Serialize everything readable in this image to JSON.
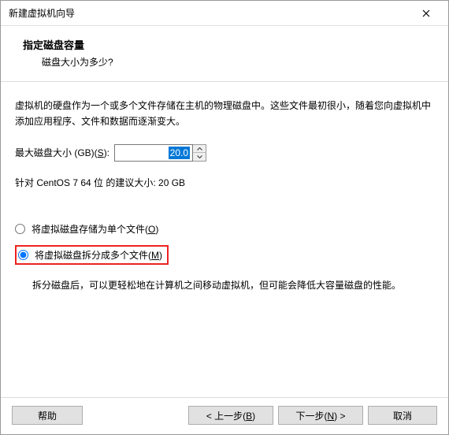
{
  "window": {
    "title": "新建虚拟机向导"
  },
  "header": {
    "title": "指定磁盘容量",
    "subtitle": "磁盘大小为多少?"
  },
  "content": {
    "description": "虚拟机的硬盘作为一个或多个文件存储在主机的物理磁盘中。这些文件最初很小，随着您向虚拟机中添加应用程序、文件和数据而逐渐变大。",
    "size_label_prefix": "最大磁盘大小 (GB)(",
    "size_label_hotkey": "S",
    "size_label_suffix": "):",
    "size_value": "20.0",
    "recommendation": "针对 CentOS 7 64 位 的建议大小: 20 GB",
    "radio_single_prefix": "将虚拟磁盘存储为单个文件(",
    "radio_single_hotkey": "O",
    "radio_single_suffix": ")",
    "radio_split_prefix": "将虚拟磁盘拆分成多个文件(",
    "radio_split_hotkey": "M",
    "radio_split_suffix": ")",
    "split_description": "拆分磁盘后，可以更轻松地在计算机之间移动虚拟机，但可能会降低大容量磁盘的性能。"
  },
  "footer": {
    "help": "帮助",
    "back_prefix": "< 上一步(",
    "back_hotkey": "B",
    "back_suffix": ")",
    "next_prefix": "下一步(",
    "next_hotkey": "N",
    "next_suffix": ") >",
    "cancel": "取消"
  }
}
